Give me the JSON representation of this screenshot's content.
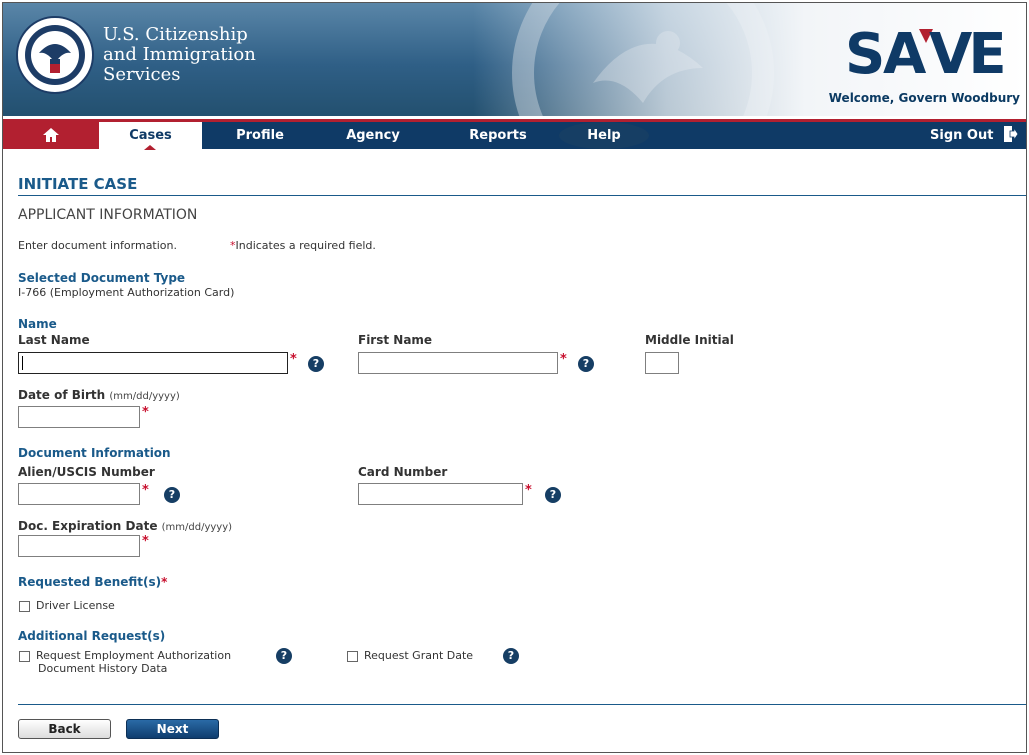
{
  "header": {
    "agency_lines": [
      "U.S. Citizenship",
      "and Immigration",
      "Services"
    ],
    "logo_text": "SAVE",
    "welcome": "Welcome, Govern Woodbury",
    "brand_colors": {
      "navy": "#0f3a66",
      "red": "#b22030",
      "link_blue": "#1a5a8a"
    }
  },
  "nav": {
    "home_icon": "home-icon",
    "items": [
      "Cases",
      "Profile",
      "Agency",
      "Reports",
      "Help"
    ],
    "active": "Cases",
    "sign_out": "Sign Out",
    "sign_out_icon": "sign-out-icon"
  },
  "page": {
    "title": "INITIATE CASE",
    "section": "APPLICANT INFORMATION",
    "instruction": "Enter document information.",
    "required_note": "Indicates a required field.",
    "selected_doc_heading": "Selected Document Type",
    "selected_doc_value": "I-766 (Employment Authorization Card)"
  },
  "name_section": {
    "heading": "Name",
    "last_name_label": "Last Name",
    "first_name_label": "First Name",
    "middle_initial_label": "Middle Initial",
    "dob_label": "Date of Birth",
    "dob_hint": "(mm/dd/yyyy)"
  },
  "document_section": {
    "heading": "Document Information",
    "alien_label": "Alien/USCIS Number",
    "card_label": "Card Number",
    "exp_label": "Doc. Expiration Date",
    "exp_hint": "(mm/dd/yyyy)"
  },
  "benefits": {
    "heading": "Requested Benefit(s)",
    "options": [
      "Driver License"
    ]
  },
  "additional": {
    "heading": "Additional Request(s)",
    "ead_line1": "Request Employment Authorization",
    "ead_line2": "Document History Data",
    "grant_date": "Request Grant Date"
  },
  "buttons": {
    "back": "Back",
    "next": "Next"
  },
  "required_marker": "*",
  "help_glyph": "?"
}
